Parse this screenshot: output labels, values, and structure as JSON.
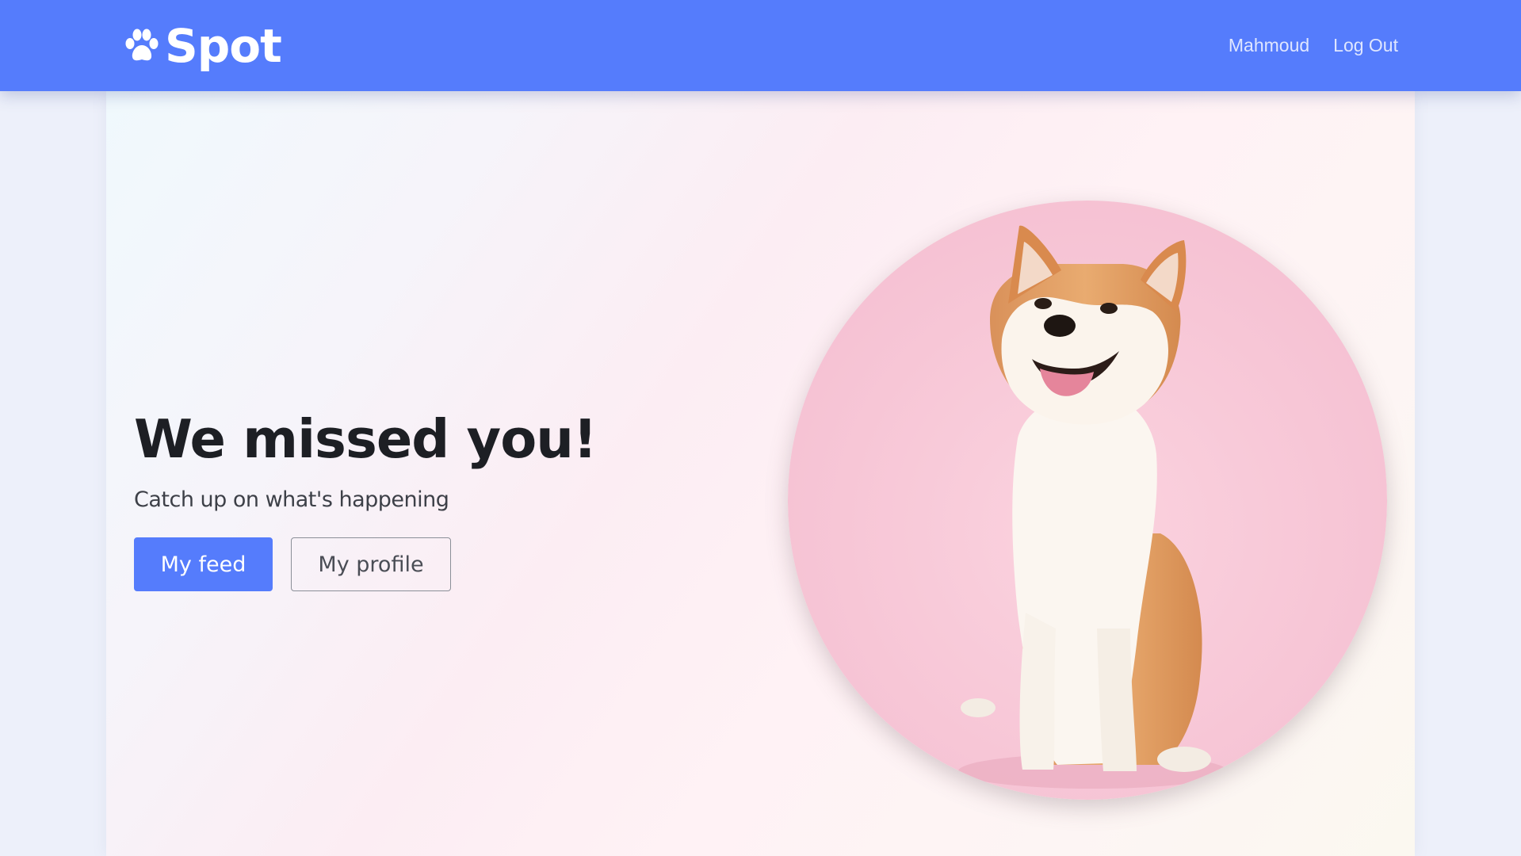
{
  "navbar": {
    "brand": "Spot",
    "brand_icon": "paw-icon",
    "background_color": "#557cfc",
    "links": [
      "Mahmoud",
      "Log Out"
    ]
  },
  "hero": {
    "headline": "We missed you!",
    "subheadline": "Catch up on what's happening",
    "buttons": {
      "primary": "My feed",
      "secondary": "My profile"
    },
    "image": "shiba-inu-dog-photo"
  },
  "colors": {
    "accent": "#557cfc",
    "photo_background": "#f7c5d6"
  }
}
